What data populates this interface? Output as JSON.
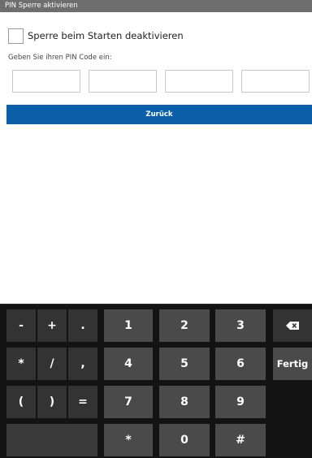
{
  "title": "PIN Sperre aktivieren",
  "checkbox": {
    "label": "Sperre beim Starten deaktivieren",
    "checked": false
  },
  "prompt": "Geben Sie ihren PIN Code ein:",
  "pin_fields": [
    "",
    "",
    "",
    ""
  ],
  "back_button": "Zurück",
  "keyboard": {
    "row1": [
      "-",
      "+",
      ".",
      "1",
      "2",
      "3"
    ],
    "row2": [
      "*",
      "/",
      ",",
      "4",
      "5",
      "6"
    ],
    "row3": [
      "(",
      ")",
      "=",
      "7",
      "8",
      "9"
    ],
    "row4": [
      "*",
      "0",
      "#"
    ],
    "done_label": "Fertig",
    "delete_icon": "backspace-icon"
  }
}
